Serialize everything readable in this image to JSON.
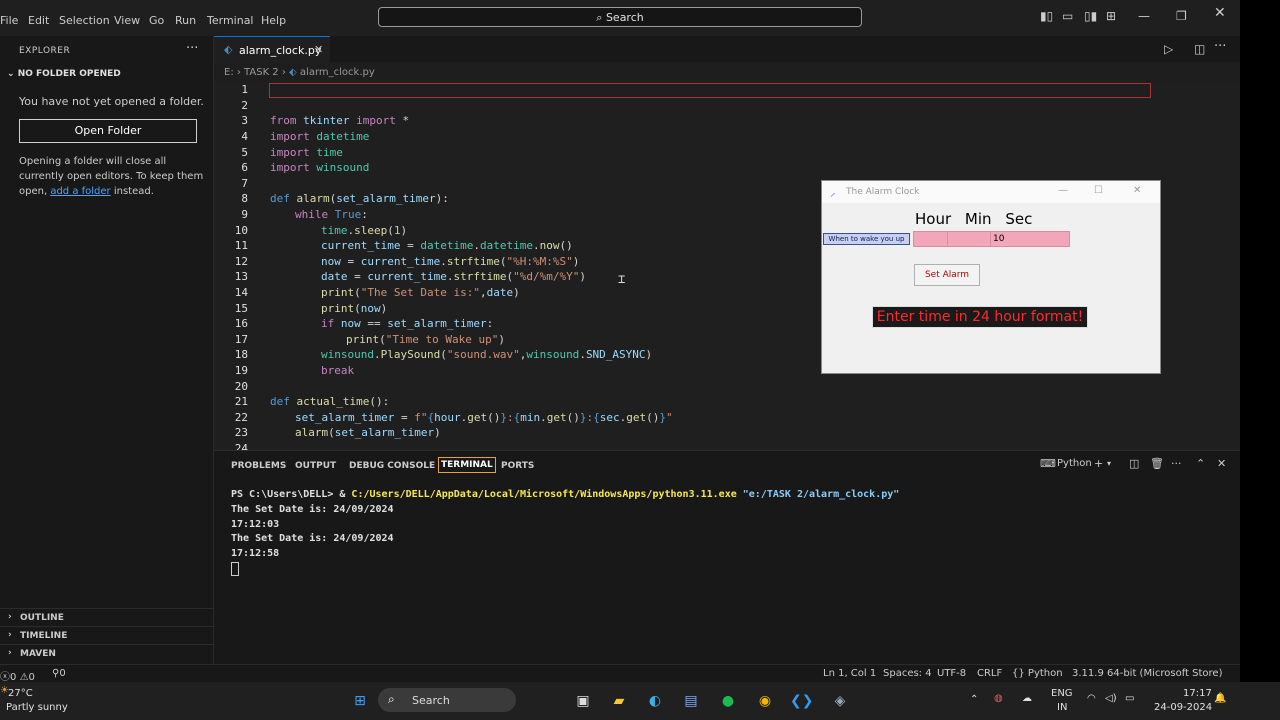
{
  "menu": [
    "File",
    "Edit",
    "Selection",
    "View",
    "Go",
    "Run",
    "Terminal",
    "Help"
  ],
  "search": {
    "label": "Search"
  },
  "sidebar": {
    "header": "EXPLORER",
    "no_folder_title": "NO FOLDER OPENED",
    "no_folder_msg": "You have not yet opened a folder.",
    "open_folder_label": "Open Folder",
    "note_text": "Opening a folder will close all currently open editors. To keep them open, ",
    "note_link": "add a folder",
    "note_end": " instead.",
    "panels": [
      "OUTLINE",
      "TIMELINE",
      "MAVEN"
    ]
  },
  "tab": {
    "name": "alarm_clock.py"
  },
  "breadcrumb": {
    "drive": "E:",
    "folder": "TASK 2",
    "file": "alarm_clock.py"
  },
  "editor": {
    "line_numbers": [
      "1",
      "2",
      "3",
      "4",
      "5",
      "6",
      "7",
      "8",
      "9",
      "10",
      "11",
      "12",
      "13",
      "14",
      "15",
      "16",
      "17",
      "18",
      "19",
      "20",
      "21",
      "22",
      "23",
      "24"
    ],
    "code": {
      "l3a": "from",
      "l3b": " tkinter ",
      "l3c": "import",
      "l3d": " *",
      "l4a": "import",
      "l4b": " datetime",
      "l5a": "import",
      "l5b": " time",
      "l6a": "import",
      "l6b": " winsound",
      "l8a": "def",
      "l8b": " alarm",
      "l8c": "(",
      "l8d": "set_alarm_timer",
      "l8e": "):",
      "l9a": "while",
      "l9b": " True",
      "l9c": ":",
      "l10a": "time",
      "l10b": ".",
      "l10c": "sleep",
      "l10d": "(",
      "l10e": "1",
      "l10f": ")",
      "l11a": "current_time",
      "l11b": " = ",
      "l11c": "datetime",
      "l11d": ".",
      "l11e": "datetime",
      "l11f": ".",
      "l11g": "now",
      "l11h": "()",
      "l12a": "now",
      "l12b": " = ",
      "l12c": "current_time",
      "l12d": ".",
      "l12e": "strftime",
      "l12f": "(",
      "l12g": "\"%H:%M:%S\"",
      "l12h": ")",
      "l13a": "date",
      "l13b": " = ",
      "l13c": "current_time",
      "l13d": ".",
      "l13e": "strftime",
      "l13f": "(",
      "l13g": "\"%d/%m/%Y\"",
      "l13h": ")",
      "l14a": "print",
      "l14b": "(",
      "l14c": "\"The Set Date is:\"",
      "l14d": ",",
      "l14e": "date",
      "l14f": ")",
      "l15a": "print",
      "l15b": "(",
      "l15c": "now",
      "l15d": ")",
      "l16a": "if",
      "l16b": " now",
      "l16c": " == ",
      "l16d": "set_alarm_timer",
      "l16e": ":",
      "l17a": "print",
      "l17b": "(",
      "l17c": "\"Time to Wake up\"",
      "l17d": ")",
      "l18a": "winsound",
      "l18b": ".",
      "l18c": "PlaySound",
      "l18d": "(",
      "l18e": "\"sound.wav\"",
      "l18f": ",",
      "l18g": "winsound",
      "l18h": ".",
      "l18i": "SND_ASYNC",
      "l18j": ")",
      "l19a": "break",
      "l21a": "def",
      "l21b": " actual_time",
      "l21c": "():",
      "l22a": "set_alarm_timer",
      "l22b": " = ",
      "l22c": "f\"",
      "l22d": "{",
      "l22e": "hour",
      "l22f": ".",
      "l22g": "get",
      "l22h": "()",
      "l22i": "}",
      "l22j": ":",
      "l22k": "{",
      "l22l": "min",
      "l22m": ".",
      "l22n": "get",
      "l22o": "()",
      "l22p": "}",
      "l22q": ":",
      "l22r": "{",
      "l22s": "sec",
      "l22t": ".",
      "l22u": "get",
      "l22v": "()",
      "l22w": "}",
      "l22x": "\"",
      "l23a": "alarm",
      "l23b": "(",
      "l23c": "set_alarm_timer",
      "l23d": ")"
    }
  },
  "alarm_window": {
    "title": "The Alarm Clock",
    "headers": [
      "Hour",
      "Min",
      "Sec"
    ],
    "label": "When to wake you up",
    "hour_value": "",
    "min_value": "",
    "sec_value": "10",
    "button_label": "Set Alarm",
    "message": "Enter time in 24 hour format!"
  },
  "panel": {
    "tabs": [
      "PROBLEMS",
      "OUTPUT",
      "DEBUG CONSOLE",
      "TERMINAL",
      "PORTS"
    ],
    "shell_label": "Python",
    "prompt": "PS C:\\Users\\DELL> & ",
    "exe": "C:/Users/DELL/AppData/Local/Microsoft/WindowsApps/python3.11.exe",
    "script_path": " \"e:/TASK 2/alarm_clock.py\"",
    "output": [
      "The Set Date is: 24/09/2024",
      "17:12:03",
      "The Set Date is: 24/09/2024",
      "17:12:58"
    ]
  },
  "statusbar": {
    "errors": "0",
    "warnings": "0",
    "ports": "0",
    "position": "Ln 1, Col 1",
    "spaces": "Spaces: 4",
    "encoding": "UTF-8",
    "eol": "CRLF",
    "language": "Python",
    "interpreter": "3.11.9 64-bit (Microsoft Store)"
  },
  "taskbar": {
    "temperature": "27°C",
    "weather": "Partly sunny",
    "search_label": "Search",
    "lang": "ENG",
    "region": "IN",
    "time": "17:17",
    "date": "24-09-2024"
  },
  "colors": {
    "accent": "#0078d4",
    "entry_pink": "#f2a6b9",
    "error_red": "#ff2a2a",
    "terminal_tab_border": "#e8a23a"
  }
}
